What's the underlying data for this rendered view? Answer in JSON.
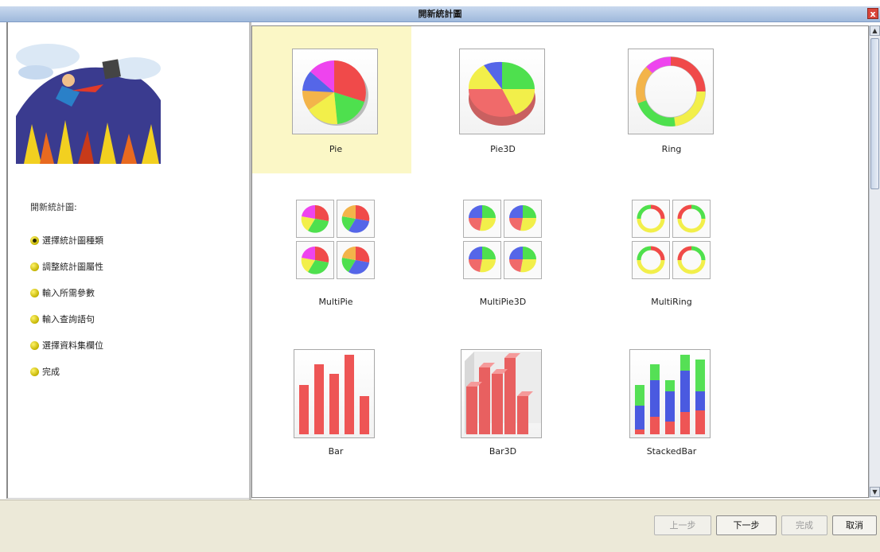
{
  "window": {
    "title": "開新統計圖",
    "close_symbol": "x"
  },
  "wizard": {
    "section_title": "開新統計圖:",
    "steps": [
      {
        "label": "選擇統計圖種類",
        "active": true
      },
      {
        "label": "調整統計圖屬性",
        "active": false
      },
      {
        "label": "輸入所需參數",
        "active": false
      },
      {
        "label": "輸入查詢語句",
        "active": false
      },
      {
        "label": "選擇資料集欄位",
        "active": false
      },
      {
        "label": "完成",
        "active": false
      }
    ]
  },
  "chart_types": [
    {
      "name": "Pie",
      "selected": true
    },
    {
      "name": "Pie3D",
      "selected": false
    },
    {
      "name": "Ring",
      "selected": false
    },
    {
      "name": "MultiPie",
      "selected": false
    },
    {
      "name": "MultiPie3D",
      "selected": false
    },
    {
      "name": "MultiRing",
      "selected": false
    },
    {
      "name": "Bar",
      "selected": false
    },
    {
      "name": "Bar3D",
      "selected": false
    },
    {
      "name": "StackedBar",
      "selected": false
    }
  ],
  "buttons": {
    "prev": "上一步",
    "next": "下一步",
    "finish": "完成",
    "cancel": "取消"
  },
  "colors": {
    "selected_bg": "#fbf7c6",
    "slice_red": "#f04a4a",
    "slice_green": "#4ee04e",
    "slice_yellow": "#f2ef4a",
    "slice_blue": "#5566e8",
    "slice_magenta": "#ee44ee",
    "slice_orange": "#f3b44a",
    "bar_red": "#ee5555",
    "bar_blue": "#4a5ae0",
    "bar_green": "#55e055"
  }
}
